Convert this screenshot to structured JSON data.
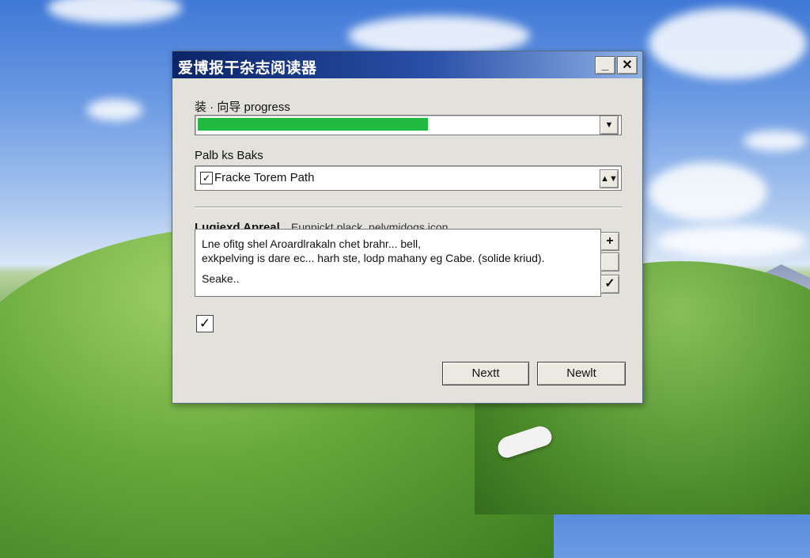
{
  "window": {
    "title": "爱博报干杂志阅读器"
  },
  "title_buttons": {
    "minimize": "_",
    "close": "✕"
  },
  "progress_section": {
    "label": "装 · 向导 progress",
    "progress": 0.54,
    "color": "#22b940"
  },
  "path_section": {
    "label": "Palb ks Baks",
    "value": "Fracke Torem Path",
    "checked": true
  },
  "agreement": {
    "heading": "Lugiexd Apreal.",
    "heading_suffix": "Eunpickt plack, pelvmidogs icon",
    "lines": [
      "Lne ofitg shel Aroardlrakaln chet brahr...              bell,",
      "exkpelving is dare ec... harh ste, lodp mahany eg Cabe. (solide kriud).",
      "Seake.."
    ]
  },
  "buttons": {
    "next": "Nextt",
    "next2": "Newlt"
  }
}
